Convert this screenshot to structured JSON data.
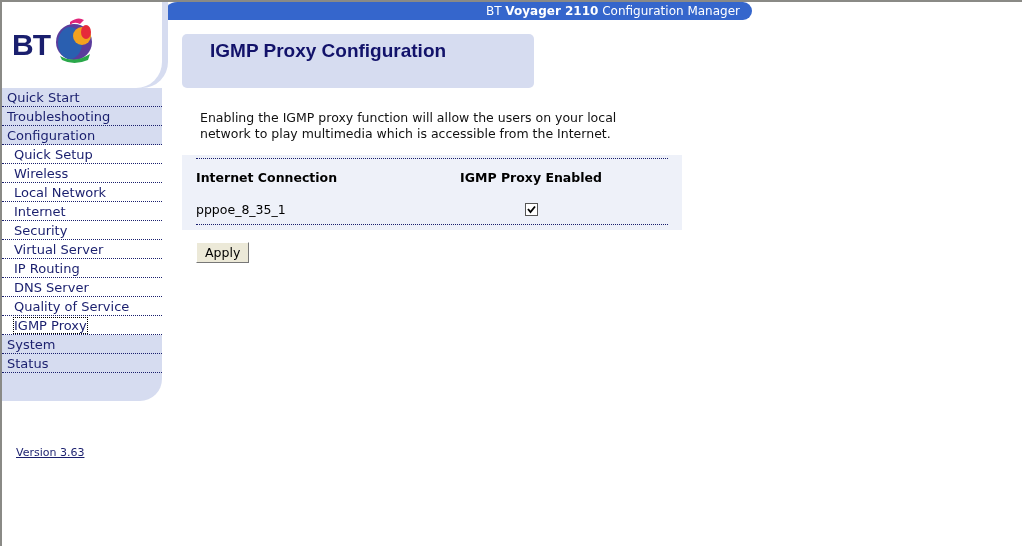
{
  "header": {
    "title": "BT **Voyager 2110** Configuration Manager"
  },
  "logo": {
    "text": "BT"
  },
  "nav": [
    {
      "label": "Quick Start",
      "selected": false
    },
    {
      "label": "Troubleshooting",
      "selected": false
    },
    {
      "label": "Configuration",
      "selected": false,
      "children": [
        {
          "label": "Quick Setup",
          "selected": false
        },
        {
          "label": "Wireless",
          "selected": false
        },
        {
          "label": "Local Network",
          "selected": false
        },
        {
          "label": "Internet",
          "selected": false
        },
        {
          "label": "Security",
          "selected": false
        },
        {
          "label": "Virtual Server",
          "selected": false
        },
        {
          "label": "IP Routing",
          "selected": false
        },
        {
          "label": "DNS Server",
          "selected": false
        },
        {
          "label": "Quality of Service",
          "selected": false
        },
        {
          "label": "IGMP Proxy",
          "selected": true
        }
      ]
    },
    {
      "label": "System",
      "selected": false
    },
    {
      "label": "Status",
      "selected": false
    }
  ],
  "version": "Version 3.63",
  "page": {
    "title": "IGMP Proxy Configuration",
    "description": "Enabling the IGMP proxy function will allow the users on your local network to play multimedia which is accessible from the Internet.",
    "table": {
      "columns": [
        "Internet Connection",
        "IGMP Proxy Enabled"
      ],
      "rows": [
        {
          "connection": "pppoe_8_35_1",
          "checked": true
        }
      ]
    },
    "buttons": [
      "Apply"
    ]
  }
}
